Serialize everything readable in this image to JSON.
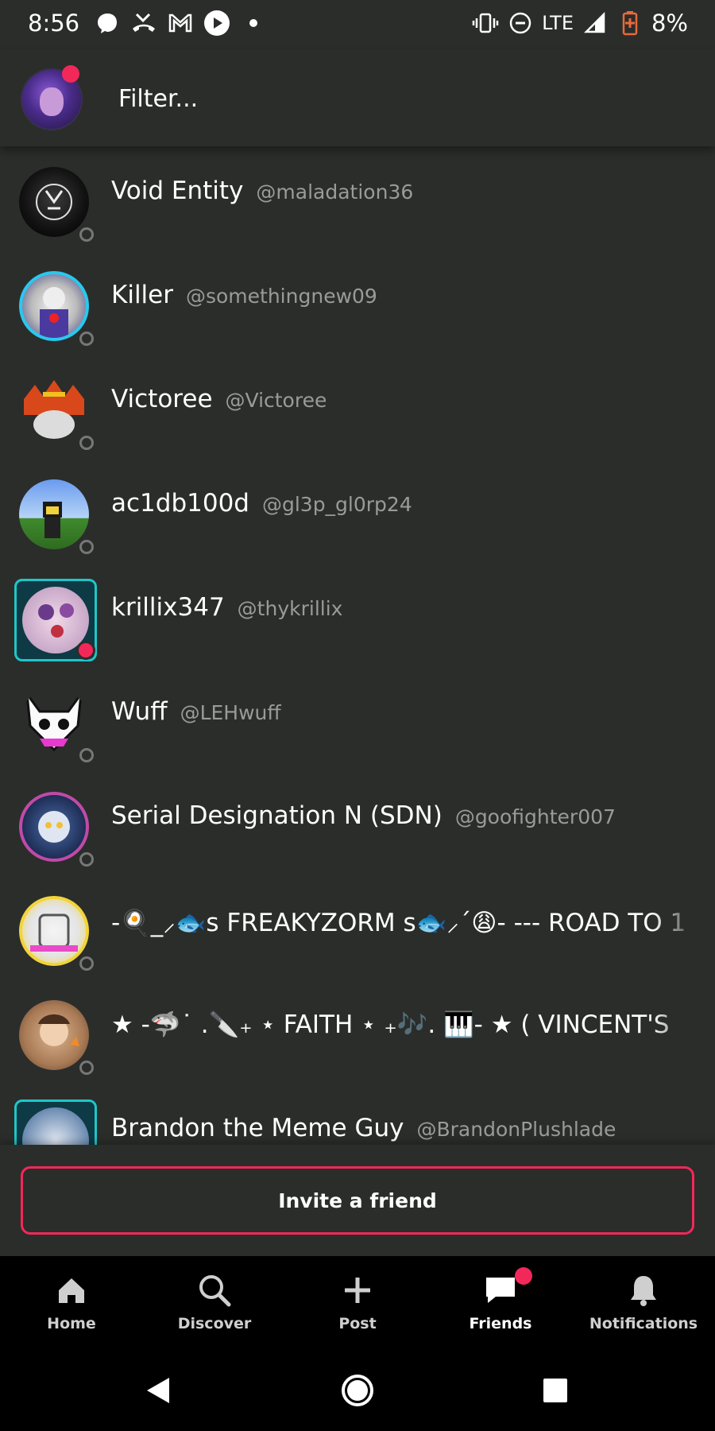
{
  "status_bar": {
    "time": "8:56",
    "network": "LTE",
    "battery": "8%",
    "left_icons": [
      "messenger-icon",
      "missed-call-icon",
      "gmail-icon",
      "play-icon",
      "dot-icon"
    ],
    "right_icons": [
      "vibrate-icon",
      "do-not-disturb-icon",
      "signal-icon",
      "battery-low-icon"
    ]
  },
  "header": {
    "filter_placeholder": "Filter..."
  },
  "friends": [
    {
      "name": "Void Entity",
      "handle": "@maladation36"
    },
    {
      "name": "Killer",
      "handle": "@somethingnew09"
    },
    {
      "name": "Victoree",
      "handle": "@Victoree"
    },
    {
      "name": "ac1db100d",
      "handle": "@gl3p_gl0rp24"
    },
    {
      "name": "krillix347",
      "handle": "@thykrillix"
    },
    {
      "name": "Wuff",
      "handle": "@LEHwuff"
    },
    {
      "name": "Serial Designation N (SDN)",
      "handle": "@goofighter007"
    },
    {
      "name": "-🍳_⸝🐟ꜱ FREAKYZORM ꜱ🐟⸝´😩- --- ROAD TO 1",
      "handle": ""
    },
    {
      "name": "★ -🦈˙ .🔪₊ ⋆ FAITH ⋆ ₊🎶. 🎹- ★ ( VINCENT'S",
      "handle": ""
    },
    {
      "name": "Brandon the Meme Guy",
      "handle": "@BrandonPlushlade"
    }
  ],
  "invite": {
    "label": "Invite a friend"
  },
  "bottom_nav": [
    {
      "label": "Home",
      "icon": "home-icon"
    },
    {
      "label": "Discover",
      "icon": "search-icon"
    },
    {
      "label": "Post",
      "icon": "plus-icon"
    },
    {
      "label": "Friends",
      "icon": "chat-icon",
      "active": true
    },
    {
      "label": "Notifications",
      "icon": "bell-icon"
    }
  ],
  "colors": {
    "background": "#2b2d2b",
    "accent": "#f2285a",
    "nav_background": "#000000",
    "handle_text": "#9a9a9a"
  }
}
